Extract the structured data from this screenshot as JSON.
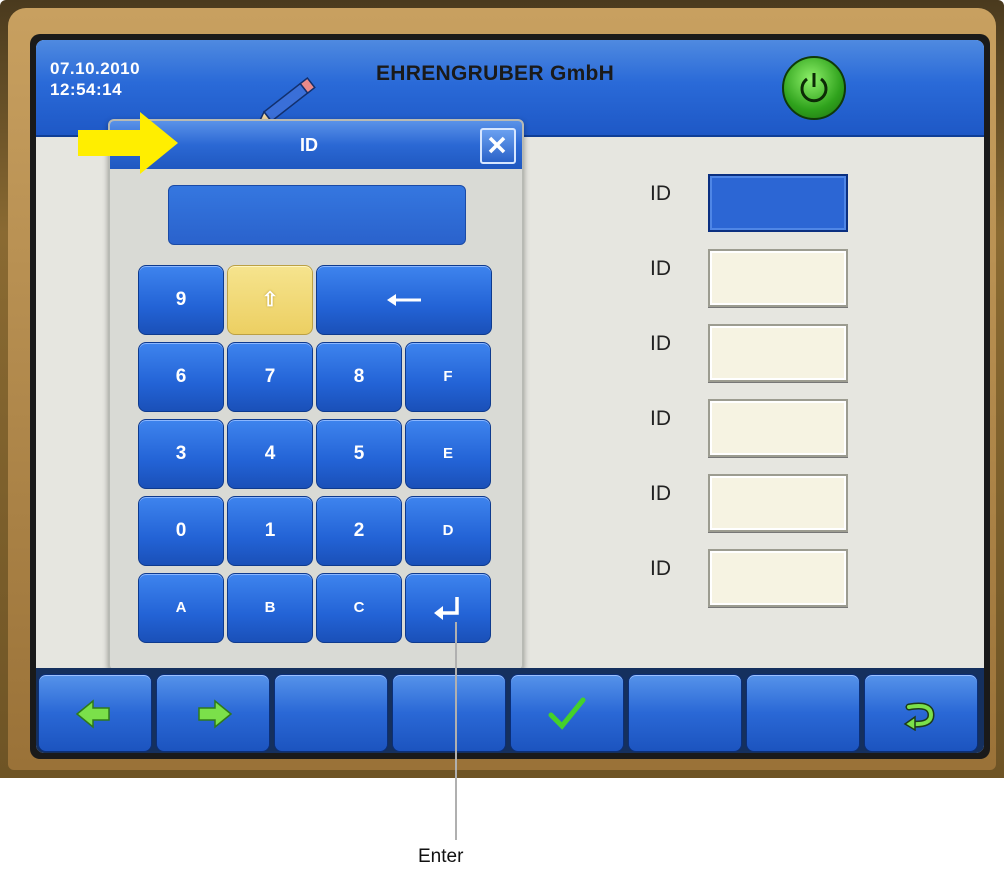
{
  "header": {
    "date": "07.10.2010",
    "time": "12:54:14",
    "title": "EHRENGRUBER GmbH"
  },
  "dialog": {
    "title": "ID",
    "display_value": "",
    "keys": [
      "9",
      "⇧",
      "←",
      "6",
      "7",
      "8",
      "F",
      "3",
      "4",
      "5",
      "E",
      "0",
      "1",
      "2",
      "D",
      "A",
      "B",
      "C",
      "↵"
    ]
  },
  "fields": [
    {
      "label": "ID",
      "value": "",
      "active": true
    },
    {
      "label": "ID",
      "value": "",
      "active": false
    },
    {
      "label": "ID",
      "value": "",
      "active": false
    },
    {
      "label": "ID",
      "value": "",
      "active": false
    },
    {
      "label": "ID",
      "value": "",
      "active": false
    },
    {
      "label": "ID",
      "value": "",
      "active": false
    }
  ],
  "bottom_bar": {
    "buttons": [
      "arrow-left-icon",
      "arrow-right-icon",
      "",
      "",
      "checkmark-icon",
      "",
      "",
      "return-icon"
    ]
  },
  "annotation": {
    "label": "Enter"
  },
  "colors": {
    "accent_blue": "#2a68d6",
    "shift_yellow": "#eccf62",
    "arrow_yellow": "#ffee00",
    "power_green": "#2fa21c",
    "check_green": "#44d12a"
  }
}
